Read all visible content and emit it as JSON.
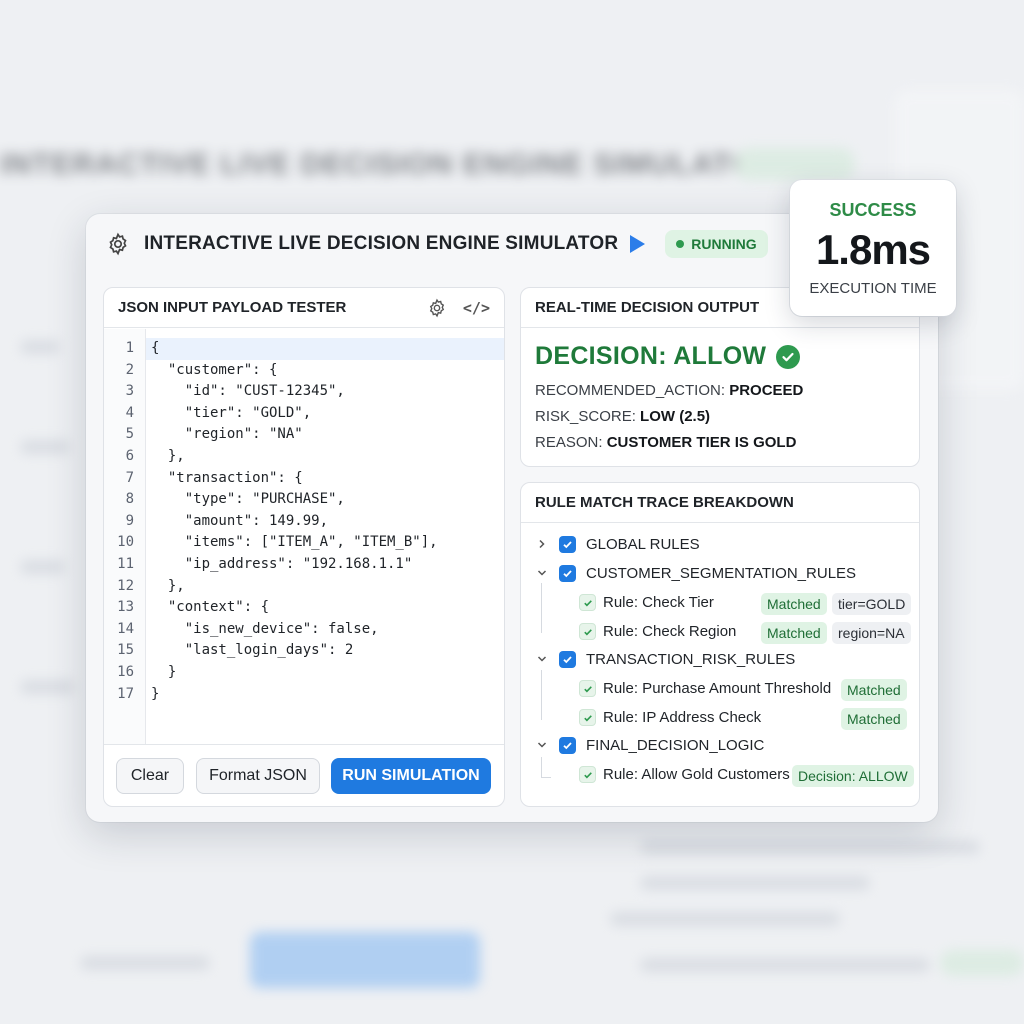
{
  "app": {
    "title": "INTERACTIVE LIVE DECISION ENGINE SIMULATOR",
    "status": "RUNNING",
    "accent_color": "#1f7ae0",
    "success_color": "#2e9a4f"
  },
  "execution": {
    "status": "SUCCESS",
    "time": "1.8ms",
    "label": "EXECUTION TIME"
  },
  "json_panel": {
    "title": "JSON INPUT PAYLOAD TESTER",
    "lines": [
      {
        "n": "1",
        "code": "{"
      },
      {
        "n": "2",
        "code": "  \"customer\": {"
      },
      {
        "n": "3",
        "code": "    \"id\": \"CUST-12345\","
      },
      {
        "n": "4",
        "code": "    \"tier\": \"GOLD\","
      },
      {
        "n": "5",
        "code": "    \"region\": \"NA\""
      },
      {
        "n": "6",
        "code": "  },"
      },
      {
        "n": "7",
        "code": "  \"transaction\": {"
      },
      {
        "n": "8",
        "code": "    \"type\": \"PURCHASE\","
      },
      {
        "n": "9",
        "code": "    \"amount\": 149.99,"
      },
      {
        "n": "10",
        "code": "    \"items\": [\"ITEM_A\", \"ITEM_B\"],"
      },
      {
        "n": "11",
        "code": "    \"ip_address\": \"192.168.1.1\""
      },
      {
        "n": "12",
        "code": "  },"
      },
      {
        "n": "13",
        "code": "  \"context\": {"
      },
      {
        "n": "14",
        "code": "    \"is_new_device\": false,"
      },
      {
        "n": "15",
        "code": "    \"last_login_days\": 2"
      },
      {
        "n": "16",
        "code": "  }"
      },
      {
        "n": "17",
        "code": "}"
      }
    ],
    "buttons": {
      "clear": "Clear",
      "format": "Format JSON",
      "run": "RUN SIMULATION"
    }
  },
  "decision_panel": {
    "title": "REAL-TIME DECISION OUTPUT",
    "decision": "DECISION: ALLOW",
    "fields": [
      {
        "key": "RECOMMENDED_ACTION:",
        "value": "PROCEED"
      },
      {
        "key": "RISK_SCORE:",
        "value": "LOW (2.5)"
      },
      {
        "key": "REASON:",
        "value": "CUSTOMER TIER IS GOLD"
      }
    ]
  },
  "trace_panel": {
    "title": "RULE MATCH TRACE BREAKDOWN",
    "groups": [
      {
        "label": "GLOBAL RULES",
        "expanded": false
      },
      {
        "label": "CUSTOMER_SEGMENTATION_RULES",
        "expanded": true
      },
      {
        "label": "TRANSACTION_RISK_RULES",
        "expanded": true
      },
      {
        "label": "FINAL_DECISION_LOGIC",
        "expanded": true
      }
    ],
    "rules": [
      {
        "label": "Rule: Check Tier",
        "status": "Matched",
        "detail": "tier=GOLD"
      },
      {
        "label": "Rule: Check Region",
        "status": "Matched",
        "detail": "region=NA"
      },
      {
        "label": "Rule: Purchase Amount Threshold",
        "status": "Matched"
      },
      {
        "label": "Rule: IP Address Check",
        "status": "Matched"
      },
      {
        "label": "Rule: Allow Gold Customers",
        "status": "Decision: ALLOW"
      }
    ]
  }
}
